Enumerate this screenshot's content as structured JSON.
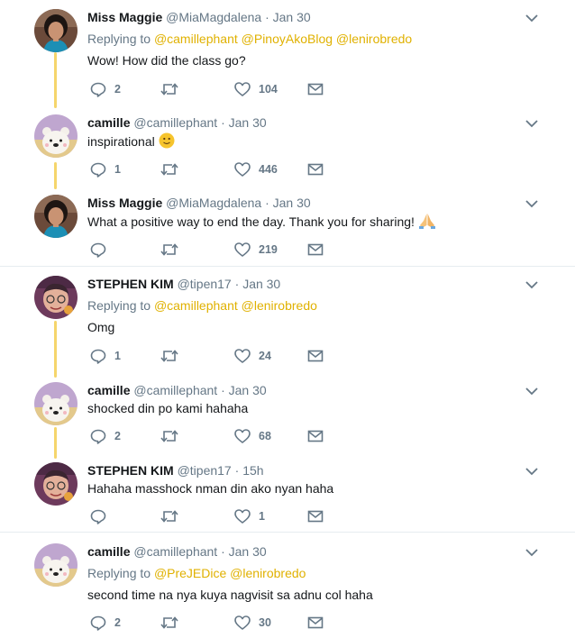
{
  "tweets": [
    {
      "name": "Miss Maggie",
      "handle": "@MiaMagdalena",
      "dot": "·",
      "time": "Jan 30",
      "replying_prefix": "Replying to",
      "mentions": [
        "@camillephant",
        "@PinoyAkoBlog",
        "@lenirobredo"
      ],
      "text": "Wow! How did the class go?",
      "reply_count": "2",
      "retweet_count": "",
      "like_count": "104",
      "avatar": "maggie-avatar"
    },
    {
      "name": "camille",
      "handle": "@camillephant",
      "dot": "·",
      "time": "Jan 30",
      "text": "inspirational",
      "emoji": "slightly-smiling-face",
      "reply_count": "1",
      "retweet_count": "",
      "like_count": "446",
      "avatar": "polar-bear-avatar"
    },
    {
      "name": "Miss Maggie",
      "handle": "@MiaMagdalena",
      "dot": "·",
      "time": "Jan 30",
      "text": "What a positive way to end the day. Thank you for sharing!",
      "emoji": "folded-hands",
      "reply_count": "",
      "retweet_count": "",
      "like_count": "219",
      "avatar": "maggie-avatar"
    },
    {
      "name": "STEPHEN KIM",
      "handle": "@tipen17",
      "dot": "·",
      "time": "Jan 30",
      "replying_prefix": "Replying to",
      "mentions": [
        "@camillephant",
        "@lenirobredo"
      ],
      "text": "Omg",
      "reply_count": "1",
      "retweet_count": "",
      "like_count": "24",
      "avatar": "stephen-avatar"
    },
    {
      "name": "camille",
      "handle": "@camillephant",
      "dot": "·",
      "time": "Jan 30",
      "text": "shocked din po kami hahaha",
      "reply_count": "2",
      "retweet_count": "",
      "like_count": "68",
      "avatar": "polar-bear-avatar"
    },
    {
      "name": "STEPHEN KIM",
      "handle": "@tipen17",
      "dot": "·",
      "time": "15h",
      "text": "Hahaha masshock nman din ako nyan haha",
      "reply_count": "",
      "retweet_count": "",
      "like_count": "1",
      "avatar": "stephen-avatar"
    },
    {
      "name": "camille",
      "handle": "@camillephant",
      "dot": "·",
      "time": "Jan 30",
      "replying_prefix": "Replying to",
      "mentions": [
        "@PreJEDice",
        "@lenirobredo"
      ],
      "text": "second time na nya kuya nagvisit sa adnu col haha",
      "reply_count": "2",
      "retweet_count": "",
      "like_count": "30",
      "avatar": "polar-bear-avatar"
    }
  ],
  "icons": {
    "reply": "reply-icon",
    "retweet": "retweet-icon",
    "like": "heart-icon",
    "message": "envelope-icon",
    "menu": "chevron-down-icon"
  },
  "colors": {
    "accent": "#e0b100",
    "thread_line": "#f5d56b",
    "muted": "#657786",
    "divider": "#e6ecf0"
  }
}
